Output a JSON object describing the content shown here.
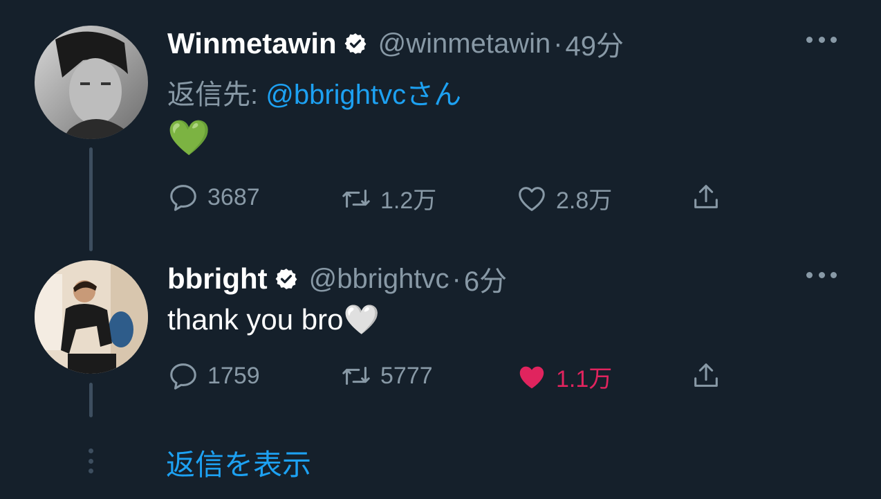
{
  "tweets": [
    {
      "display_name": "Winmetawin",
      "handle": "@winmetawin",
      "separator": "·",
      "time": "49分",
      "replying_prefix": "返信先: ",
      "replying_to": "@bbrightvc",
      "replying_suffix": "さん",
      "text": "💚",
      "replies": "3687",
      "retweets": "1.2万",
      "likes": "2.8万",
      "liked": false
    },
    {
      "display_name": "bbright",
      "handle": "@bbrightvc",
      "separator": "·",
      "time": "6分",
      "text": "thank you bro🤍",
      "replies": "1759",
      "retweets": "5777",
      "likes": "1.1万",
      "liked": true
    }
  ],
  "show_replies_label": "返信を表示",
  "colors": {
    "background": "#15202b",
    "secondary_text": "#8899a6",
    "link": "#1da1f2",
    "like_active": "#e0245e",
    "thread_line": "#3d4e5f"
  }
}
